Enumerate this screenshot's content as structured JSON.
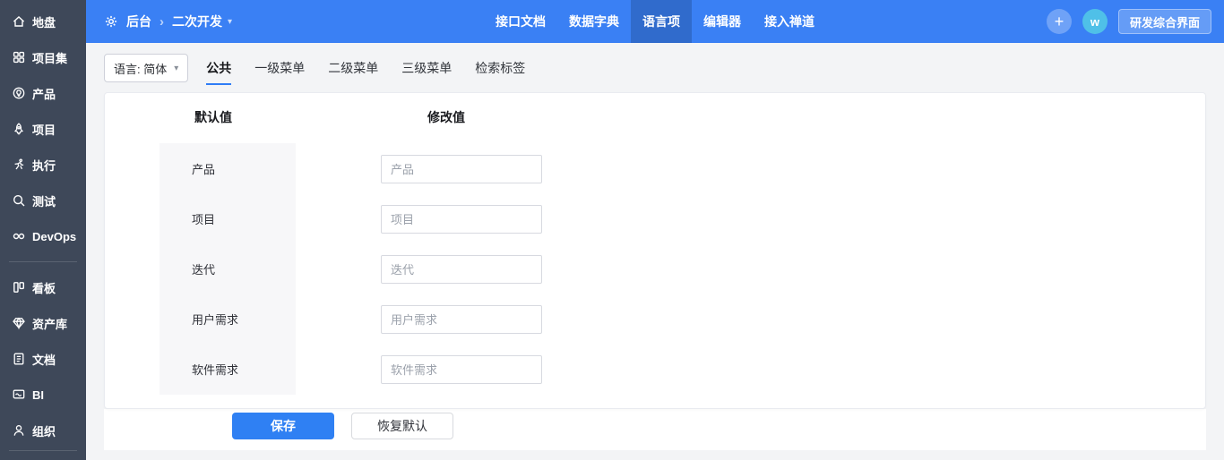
{
  "sidebar": {
    "items": [
      {
        "label": "地盘",
        "icon": "home-icon"
      },
      {
        "label": "项目集",
        "icon": "program-grid-icon"
      },
      {
        "label": "产品",
        "icon": "product-bulb-icon"
      },
      {
        "label": "项目",
        "icon": "project-rocket-icon"
      },
      {
        "label": "执行",
        "icon": "execution-runner-icon"
      },
      {
        "label": "测试",
        "icon": "qa-magnifier-icon"
      },
      {
        "label": "DevOps",
        "icon": "devops-infinity-icon"
      },
      {
        "label": "看板",
        "icon": "kanban-board-icon"
      },
      {
        "label": "资产库",
        "icon": "assets-gem-icon"
      },
      {
        "label": "文档",
        "icon": "document-icon"
      },
      {
        "label": "BI",
        "icon": "bi-monitor-icon"
      },
      {
        "label": "组织",
        "icon": "organization-user-icon"
      }
    ]
  },
  "topbar": {
    "breadcrumb": {
      "root": "后台",
      "separator": "›",
      "current": "二次开发",
      "caret": "▾"
    },
    "nav": [
      "接口文档",
      "数据字典",
      "语言项",
      "编辑器",
      "接入禅道"
    ],
    "active_nav": "语言项",
    "plus": "+",
    "avatar": "w",
    "action_button": "研发综合界面"
  },
  "toolbar": {
    "language_label": "语言: 简体",
    "caret": "▾",
    "tabs": [
      "公共",
      "一级菜单",
      "二级菜单",
      "三级菜单",
      "检索标签"
    ],
    "active_tab": "公共"
  },
  "form": {
    "col_default": "默认值",
    "col_modified": "修改值",
    "rows": [
      {
        "label": "产品",
        "placeholder": "产品",
        "value": ""
      },
      {
        "label": "项目",
        "placeholder": "项目",
        "value": ""
      },
      {
        "label": "迭代",
        "placeholder": "迭代",
        "value": ""
      },
      {
        "label": "用户需求",
        "placeholder": "用户需求",
        "value": ""
      },
      {
        "label": "软件需求",
        "placeholder": "软件需求",
        "value": ""
      }
    ],
    "save_label": "保存",
    "reset_label": "恢复默认"
  },
  "colors": {
    "topbar": "#3a80f4",
    "topbar_active_item": "rgba(0,0,0,0.16)",
    "sidebar": "#3e4859",
    "accent": "#2f80f3",
    "avatar_bg": "#4fc0e8",
    "content_bg": "#f3f4f6",
    "default_panel_bg": "#f7f7f9"
  }
}
